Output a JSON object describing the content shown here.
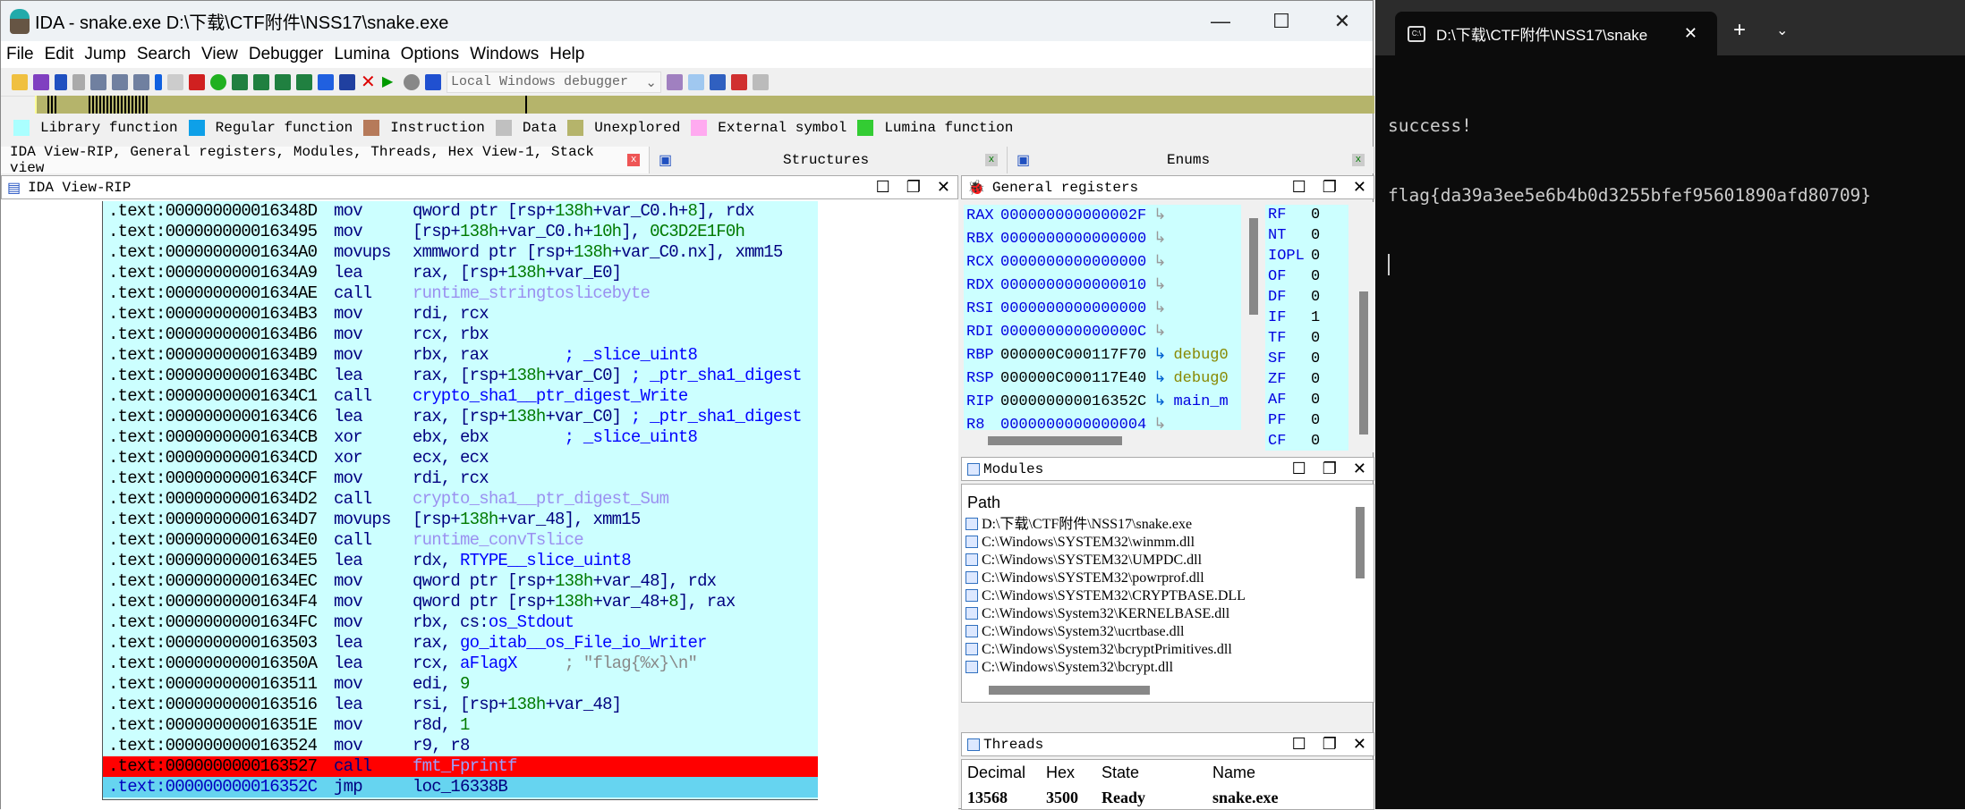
{
  "window": {
    "title": "IDA - snake.exe D:\\下载\\CTF附件\\NSS17\\snake.exe",
    "min": "—",
    "max": "☐",
    "close": "✕"
  },
  "menu": [
    "File",
    "Edit",
    "Jump",
    "Search",
    "View",
    "Debugger",
    "Lumina",
    "Options",
    "Windows",
    "Help"
  ],
  "toolbar": {
    "debugger_select": "Local Windows debugger"
  },
  "legend": [
    {
      "label": "Library function",
      "color": "#aaffff"
    },
    {
      "label": "Regular function",
      "color": "#0ea0e8"
    },
    {
      "label": "Instruction",
      "color": "#b67a5a"
    },
    {
      "label": "Data",
      "color": "#c0c0c0"
    },
    {
      "label": "Unexplored",
      "color": "#b5b46b"
    },
    {
      "label": "External symbol",
      "color": "#ffaaf0"
    },
    {
      "label": "Lumina function",
      "color": "#33cc33"
    }
  ],
  "tabs": [
    {
      "label": "IDA View-RIP, General registers, Modules, Threads, Hex View-1, Stack view"
    },
    {
      "label": "Structures"
    },
    {
      "label": "Enums"
    }
  ],
  "disasm": {
    "title": "IDA View-RIP",
    "lines": [
      {
        "addr": ".text:000000000016348D",
        "mn": "mov",
        "op": [
          [
            "k",
            "qword ptr [rsp+"
          ],
          [
            "g",
            "138h"
          ],
          [
            "k",
            "+var_C0.h+"
          ],
          [
            "g",
            "8"
          ],
          [
            "k",
            "], rdx"
          ]
        ]
      },
      {
        "addr": ".text:0000000000163495",
        "mn": "mov",
        "op": [
          [
            "k",
            "[rsp+"
          ],
          [
            "g",
            "138h"
          ],
          [
            "k",
            "+var_C0.h+"
          ],
          [
            "g",
            "10h"
          ],
          [
            "k",
            "], "
          ],
          [
            "g",
            "0C3D2E1F0h"
          ]
        ]
      },
      {
        "addr": ".text:00000000001634A0",
        "mn": "movups",
        "op": [
          [
            "k",
            "xmmword ptr [rsp+"
          ],
          [
            "g",
            "138h"
          ],
          [
            "k",
            "+var_C0.nx], xmm15"
          ]
        ]
      },
      {
        "addr": ".text:00000000001634A9",
        "mn": "lea",
        "op": [
          [
            "k",
            "rax, [rsp+"
          ],
          [
            "g",
            "138h"
          ],
          [
            "k",
            "+var_E0]"
          ]
        ]
      },
      {
        "addr": ".text:00000000001634AE",
        "mn": "call",
        "op": [
          [
            "f",
            "runtime_stringtoslicebyte"
          ]
        ]
      },
      {
        "addr": ".text:00000000001634B3",
        "mn": "mov",
        "op": [
          [
            "k",
            "rdi, rcx"
          ]
        ]
      },
      {
        "addr": ".text:00000000001634B6",
        "mn": "mov",
        "op": [
          [
            "k",
            "rcx, rbx"
          ]
        ]
      },
      {
        "addr": ".text:00000000001634B9",
        "mn": "mov",
        "op": [
          [
            "k",
            "rbx, rax        "
          ],
          [
            "b",
            "; _slice_uint8"
          ]
        ]
      },
      {
        "addr": ".text:00000000001634BC",
        "mn": "lea",
        "op": [
          [
            "k",
            "rax, [rsp+"
          ],
          [
            "g",
            "138h"
          ],
          [
            "k",
            "+var_C0] "
          ],
          [
            "b",
            "; _ptr_sha1_digest"
          ]
        ]
      },
      {
        "addr": ".text:00000000001634C1",
        "mn": "call",
        "op": [
          [
            "b",
            "crypto_sha1__ptr_digest_Write"
          ]
        ]
      },
      {
        "addr": ".text:00000000001634C6",
        "mn": "lea",
        "op": [
          [
            "k",
            "rax, [rsp+"
          ],
          [
            "g",
            "138h"
          ],
          [
            "k",
            "+var_C0] "
          ],
          [
            "b",
            "; _ptr_sha1_digest"
          ]
        ]
      },
      {
        "addr": ".text:00000000001634CB",
        "mn": "xor",
        "op": [
          [
            "k",
            "ebx, ebx        "
          ],
          [
            "b",
            "; _slice_uint8"
          ]
        ]
      },
      {
        "addr": ".text:00000000001634CD",
        "mn": "xor",
        "op": [
          [
            "k",
            "ecx, ecx"
          ]
        ]
      },
      {
        "addr": ".text:00000000001634CF",
        "mn": "mov",
        "op": [
          [
            "k",
            "rdi, rcx"
          ]
        ]
      },
      {
        "addr": ".text:00000000001634D2",
        "mn": "call",
        "op": [
          [
            "f",
            "crypto_sha1__ptr_digest_Sum"
          ]
        ]
      },
      {
        "addr": ".text:00000000001634D7",
        "mn": "movups",
        "op": [
          [
            "k",
            "[rsp+"
          ],
          [
            "g",
            "138h"
          ],
          [
            "k",
            "+var_48], xmm15"
          ]
        ]
      },
      {
        "addr": ".text:00000000001634E0",
        "mn": "call",
        "op": [
          [
            "f",
            "runtime_convTslice"
          ]
        ]
      },
      {
        "addr": ".text:00000000001634E5",
        "mn": "lea",
        "op": [
          [
            "k",
            "rdx, "
          ],
          [
            "b",
            "RTYPE__slice_uint8"
          ]
        ]
      },
      {
        "addr": ".text:00000000001634EC",
        "mn": "mov",
        "op": [
          [
            "k",
            "qword ptr [rsp+"
          ],
          [
            "g",
            "138h"
          ],
          [
            "k",
            "+var_48], rdx"
          ]
        ]
      },
      {
        "addr": ".text:00000000001634F4",
        "mn": "mov",
        "op": [
          [
            "k",
            "qword ptr [rsp+"
          ],
          [
            "g",
            "138h"
          ],
          [
            "k",
            "+var_48+"
          ],
          [
            "g",
            "8"
          ],
          [
            "k",
            "], rax"
          ]
        ]
      },
      {
        "addr": ".text:00000000001634FC",
        "mn": "mov",
        "op": [
          [
            "k",
            "rbx, cs:"
          ],
          [
            "b",
            "os_Stdout"
          ]
        ]
      },
      {
        "addr": ".text:0000000000163503",
        "mn": "lea",
        "op": [
          [
            "k",
            "rax, "
          ],
          [
            "b",
            "go_itab__os_File_io_Writer"
          ]
        ]
      },
      {
        "addr": ".text:000000000016350A",
        "mn": "lea",
        "op": [
          [
            "k",
            "rcx, "
          ],
          [
            "b",
            "aFlagX"
          ],
          [
            "k",
            "     "
          ],
          [
            "s",
            "; \"flag{%x}\\n\""
          ]
        ]
      },
      {
        "addr": ".text:0000000000163511",
        "mn": "mov",
        "op": [
          [
            "k",
            "edi, "
          ],
          [
            "g",
            "9"
          ]
        ]
      },
      {
        "addr": ".text:0000000000163516",
        "mn": "lea",
        "op": [
          [
            "k",
            "rsi, [rsp+"
          ],
          [
            "g",
            "138h"
          ],
          [
            "k",
            "+var_48]"
          ]
        ]
      },
      {
        "addr": ".text:000000000016351E",
        "mn": "mov",
        "op": [
          [
            "k",
            "r8d, "
          ],
          [
            "g",
            "1"
          ]
        ]
      },
      {
        "addr": ".text:0000000000163524",
        "mn": "mov",
        "op": [
          [
            "k",
            "r9, r8"
          ]
        ]
      },
      {
        "addr": ".text:0000000000163527",
        "mn": "call",
        "op": [
          [
            "f",
            "fmt_Fprintf"
          ]
        ],
        "state": "breakpoint"
      },
      {
        "addr": ".text:000000000016352C",
        "mn": "jmp",
        "op": [
          [
            "k",
            "loc_16338B"
          ]
        ],
        "state": "current"
      }
    ]
  },
  "registers": {
    "title": "General registers",
    "items": [
      {
        "name": "RAX",
        "value": "000000000000002F",
        "target": ""
      },
      {
        "name": "RBX",
        "value": "0000000000000000",
        "target": ""
      },
      {
        "name": "RCX",
        "value": "0000000000000000",
        "target": ""
      },
      {
        "name": "RDX",
        "value": "0000000000000010",
        "target": ""
      },
      {
        "name": "RSI",
        "value": "0000000000000000",
        "target": ""
      },
      {
        "name": "RDI",
        "value": "000000000000000C",
        "target": ""
      },
      {
        "name": "RBP",
        "value": "000000C000117F70",
        "target": "debug0"
      },
      {
        "name": "RSP",
        "value": "000000C000117E40",
        "target": "debug0"
      },
      {
        "name": "RIP",
        "value": "000000000016352C",
        "target": "main_m"
      },
      {
        "name": "R8",
        "value": "0000000000000004",
        "target": ""
      }
    ],
    "flags": [
      {
        "name": "RF",
        "value": "0"
      },
      {
        "name": "NT",
        "value": "0"
      },
      {
        "name": "IOPL",
        "value": "0"
      },
      {
        "name": "OF",
        "value": "0"
      },
      {
        "name": "DF",
        "value": "0"
      },
      {
        "name": "IF",
        "value": "1"
      },
      {
        "name": "TF",
        "value": "0"
      },
      {
        "name": "SF",
        "value": "0"
      },
      {
        "name": "ZF",
        "value": "0"
      },
      {
        "name": "AF",
        "value": "0"
      },
      {
        "name": "PF",
        "value": "0"
      },
      {
        "name": "CF",
        "value": "0"
      }
    ]
  },
  "modules": {
    "title": "Modules",
    "column": "Path",
    "items": [
      "D:\\下载\\CTF附件\\NSS17\\snake.exe",
      "C:\\Windows\\SYSTEM32\\winmm.dll",
      "C:\\Windows\\SYSTEM32\\UMPDC.dll",
      "C:\\Windows\\SYSTEM32\\powrprof.dll",
      "C:\\Windows\\SYSTEM32\\CRYPTBASE.DLL",
      "C:\\Windows\\System32\\KERNELBASE.dll",
      "C:\\Windows\\System32\\ucrtbase.dll",
      "C:\\Windows\\System32\\bcryptPrimitives.dll",
      "C:\\Windows\\System32\\bcrypt.dll"
    ]
  },
  "threads": {
    "title": "Threads",
    "columns": [
      "Decimal",
      "Hex",
      "State",
      "Name"
    ],
    "rows": [
      [
        "13568",
        "3500",
        "Ready",
        "snake.exe"
      ]
    ]
  },
  "terminal": {
    "tab_title": "D:\\下载\\CTF附件\\NSS17\\snake",
    "icon_text": "C:\\",
    "lines": [
      "success!",
      "flag{da39a3ee5e6b4b0d3255bfef95601890afd80709}"
    ]
  }
}
